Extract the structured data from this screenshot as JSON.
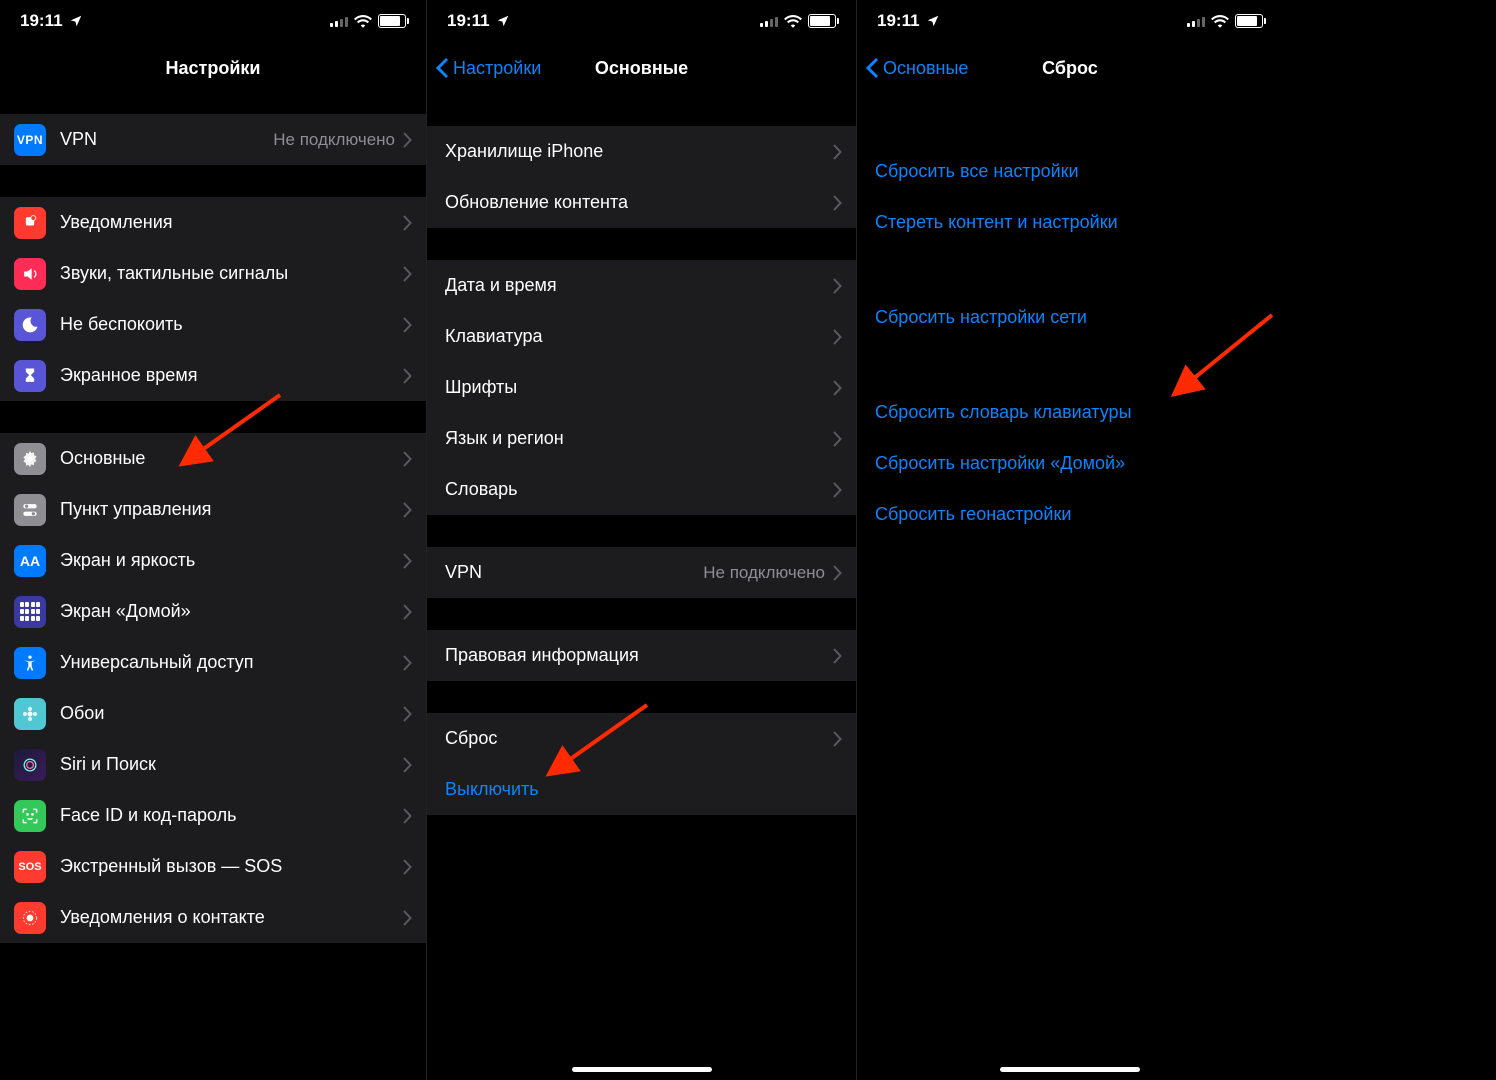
{
  "status": {
    "time": "19:11"
  },
  "colors": {
    "link": "#0a84ff",
    "row_bg": "#1c1c1e",
    "detail": "#8e8e93"
  },
  "phone_a": {
    "nav": {
      "title": "Настройки"
    },
    "sections": [
      {
        "rows": [
          {
            "icon": "vpn",
            "label": "VPN",
            "detail": "Не подключено"
          }
        ]
      },
      {
        "rows": [
          {
            "icon": "notif",
            "label": "Уведомления"
          },
          {
            "icon": "sound",
            "label": "Звуки, тактильные сигналы"
          },
          {
            "icon": "dnd",
            "label": "Не беспокоить"
          },
          {
            "icon": "screentime",
            "label": "Экранное время"
          }
        ]
      },
      {
        "rows": [
          {
            "icon": "general",
            "label": "Основные"
          },
          {
            "icon": "control",
            "label": "Пункт управления"
          },
          {
            "icon": "display",
            "label": "Экран и яркость"
          },
          {
            "icon": "home",
            "label": "Экран «Домой»"
          },
          {
            "icon": "access",
            "label": "Универсальный доступ"
          },
          {
            "icon": "wallpaper",
            "label": "Обои"
          },
          {
            "icon": "siri",
            "label": "Siri и Поиск"
          },
          {
            "icon": "faceid",
            "label": "Face ID и код-пароль"
          },
          {
            "icon": "sos",
            "label": "Экстренный вызов — SOS"
          },
          {
            "icon": "exposure",
            "label": "Уведомления о контакте"
          }
        ]
      }
    ]
  },
  "phone_b": {
    "nav": {
      "back": "Настройки",
      "title": "Основные"
    },
    "sections": [
      {
        "rows": [
          {
            "label": "Хранилище iPhone"
          },
          {
            "label": "Обновление контента"
          }
        ]
      },
      {
        "rows": [
          {
            "label": "Дата и время"
          },
          {
            "label": "Клавиатура"
          },
          {
            "label": "Шрифты"
          },
          {
            "label": "Язык и регион"
          },
          {
            "label": "Словарь"
          }
        ]
      },
      {
        "rows": [
          {
            "label": "VPN",
            "detail": "Не подключено"
          }
        ]
      },
      {
        "rows": [
          {
            "label": "Правовая информация"
          }
        ]
      },
      {
        "rows": [
          {
            "label": "Сброс"
          },
          {
            "label": "Выключить",
            "link": true,
            "no_chevron": true
          }
        ]
      }
    ]
  },
  "phone_c": {
    "nav": {
      "back": "Основные",
      "title": "Сброс"
    },
    "sections": [
      {
        "rows": [
          {
            "label": "Сбросить все настройки"
          },
          {
            "label": "Стереть контент и настройки"
          }
        ]
      },
      {
        "rows": [
          {
            "label": "Сбросить настройки сети"
          }
        ]
      },
      {
        "rows": [
          {
            "label": "Сбросить словарь клавиатуры"
          },
          {
            "label": "Сбросить настройки «Домой»"
          },
          {
            "label": "Сбросить геонастройки"
          }
        ]
      }
    ]
  }
}
